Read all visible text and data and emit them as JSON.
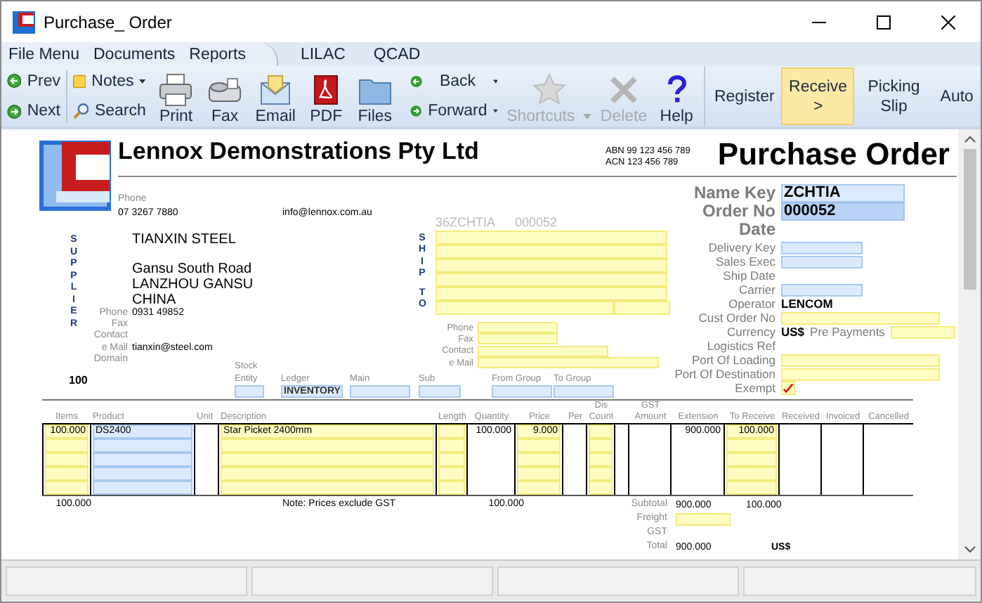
{
  "window": {
    "title": "Purchase_ Order"
  },
  "menu": {
    "tab": [
      "File Menu",
      "Documents",
      "Reports"
    ],
    "links": [
      "LILAC",
      "QCAD"
    ]
  },
  "toolbar": {
    "nav": [
      {
        "label": "Prev"
      },
      {
        "label": "Next"
      }
    ],
    "notes": [
      {
        "label": "Notes",
        "dropdown": true
      },
      {
        "label": "Search",
        "dropdown": false
      }
    ],
    "actions": [
      {
        "label": "Print"
      },
      {
        "label": "Fax"
      },
      {
        "label": "Email"
      },
      {
        "label": "PDF"
      },
      {
        "label": "Files"
      }
    ],
    "history": [
      {
        "label": "Back",
        "dropdown": true
      },
      {
        "label": "Forward",
        "dropdown": true
      }
    ],
    "tools": [
      {
        "label": "Shortcuts",
        "disabled": true,
        "dropdown": true
      },
      {
        "label": "Delete",
        "disabled": true,
        "dropdown": false
      },
      {
        "label": "Help",
        "disabled": false,
        "dropdown": false
      }
    ],
    "workflow": [
      {
        "label": "Register",
        "selected": false
      },
      {
        "label": "Receive >",
        "selected": true
      },
      {
        "label": "Picking Slip",
        "selected": false
      },
      {
        "label": "Auto",
        "selected": false
      }
    ]
  },
  "document": {
    "company": "Lennox Demonstrations Pty Ltd",
    "abn": "ABN 99 123 456 789",
    "acn": "ACN 123 456 789",
    "title": "Purchase Order",
    "phone_label": "Phone",
    "phone": "07 3267 7880",
    "email": "info@lennox.com.au",
    "supplier": {
      "label": "SUPPLIER",
      "name": "TIANXIN STEEL",
      "address": [
        "Gansu South Road",
        "LANZHOU GANSU",
        "CHINA"
      ],
      "contacts": [
        {
          "label": "Phone",
          "value": "0931 49852"
        },
        {
          "label": "Fax"
        },
        {
          "label": "Contact"
        },
        {
          "label": "e Mail",
          "value": "tianxin@steel.com"
        },
        {
          "label": "Domain"
        }
      ],
      "code": "100"
    },
    "ship_to": {
      "label": [
        "SHIP",
        "TO"
      ],
      "ref": "36ZCHTIA",
      "order": "000052",
      "contacts": [
        {
          "label": "Phone"
        },
        {
          "label": "Fax"
        },
        {
          "label": "Contact"
        },
        {
          "label": "e Mail"
        }
      ]
    },
    "accounts": [
      {
        "label": [
          "Stock",
          "Entity"
        ]
      },
      {
        "label": [
          "Ledger"
        ],
        "value": "INVENTORY"
      },
      {
        "label": [
          "Main"
        ]
      },
      {
        "label": [
          "Sub"
        ]
      },
      {
        "label": [
          "From Group"
        ]
      },
      {
        "label": [
          "To Group"
        ]
      }
    ],
    "info": [
      {
        "label": "Name Key",
        "kind": "key",
        "value": "ZCHTIA",
        "focused": false
      },
      {
        "label": "Order No",
        "kind": "key",
        "value": "000052",
        "focused": true
      },
      {
        "label": "Date",
        "kind": "heading"
      },
      {
        "label": "Delivery Key",
        "kind": "lookup"
      },
      {
        "label": "Sales Exec",
        "kind": "lookup"
      },
      {
        "label": "Ship Date",
        "kind": "plain"
      },
      {
        "label": "Carrier",
        "kind": "lookup"
      },
      {
        "label": "Operator",
        "kind": "plain",
        "value": "LENCOM"
      },
      {
        "label": "Cust Order No",
        "kind": "entry"
      },
      {
        "label": "Currency",
        "kind": "currency",
        "value": "US$",
        "extra_label": "Pre Payments"
      },
      {
        "label": "Logistics Ref",
        "kind": "plain"
      },
      {
        "label": "Port Of Loading",
        "kind": "entry"
      },
      {
        "label": "Port Of Destination",
        "kind": "entry"
      },
      {
        "label": "Exempt",
        "kind": "check",
        "checked": true
      }
    ],
    "table": {
      "columns": [
        {
          "label": "Items",
          "kind": "entry"
        },
        {
          "label": "Product",
          "kind": "lookup"
        },
        {
          "label": "Unit",
          "kind": "plain"
        },
        {
          "label": "Description",
          "kind": "entry"
        },
        {
          "label": "Length",
          "kind": "entry"
        },
        {
          "label": "Quantity",
          "kind": "plain"
        },
        {
          "label": "Price",
          "kind": "entry"
        },
        {
          "label": "Per",
          "kind": "plain"
        },
        {
          "label": "Dis Count",
          "kind": "entry"
        },
        {
          "kind": "plain"
        },
        {
          "label": "GST Amount",
          "kind": "plain"
        },
        {
          "label": "Extension",
          "kind": "plain"
        },
        {
          "label": "To Receive",
          "kind": "entry"
        },
        {
          "label": "Received",
          "kind": "plain"
        },
        {
          "label": "Invoiced",
          "kind": "plain"
        },
        {
          "label": "Cancelled",
          "kind": "plain"
        }
      ],
      "rows": [
        {
          "items": "100.000",
          "product": "DS2400",
          "description": "Star Picket 2400mm",
          "quantity": "100.000",
          "price": "9.000",
          "extension": "900.000",
          "to_receive": "100.000"
        }
      ]
    },
    "totals": {
      "items": "100.000",
      "note": "Note: Prices exclude GST",
      "quantity": "100.000",
      "summary": [
        {
          "label": "Subtotal",
          "kind": "plain",
          "extension": "900.000",
          "to_receive": "100.000"
        },
        {
          "label": "Freight",
          "kind": "entry"
        },
        {
          "label": "GST",
          "kind": "plain"
        },
        {
          "label": "Total",
          "kind": "plain",
          "extension": "900.000",
          "currency": "US$"
        }
      ]
    }
  }
}
